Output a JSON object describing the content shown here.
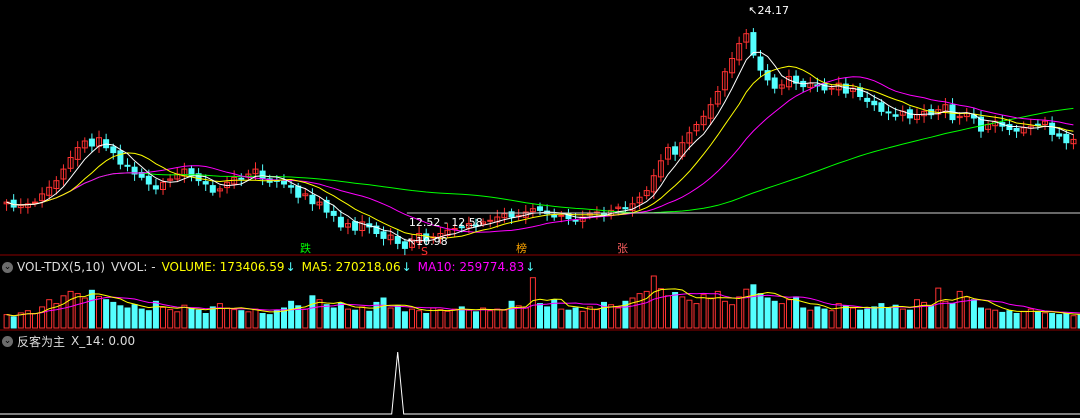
{
  "chart_data": [
    {
      "type": "candlestick",
      "price_range": [
        10.0,
        24.9
      ],
      "overlay_lines": [
        "MA5",
        "MA10",
        "MA20",
        "MA60"
      ],
      "colors": {
        "up": "#ff3232",
        "down": "#54ffff",
        "ma5": "#ffffff",
        "ma10": "#ffff00",
        "ma20": "#ff00ff",
        "ma60": "#00ff00",
        "grid": "#8c0000"
      },
      "closes": [
        12.9,
        12.6,
        12.7,
        12.8,
        12.9,
        13.4,
        13.8,
        14.2,
        14.9,
        15.6,
        16.2,
        16.6,
        16.3,
        16.8,
        16.2,
        15.9,
        15.2,
        15.1,
        14.6,
        14.4,
        14.0,
        13.7,
        14.1,
        14.3,
        14.6,
        14.9,
        14.5,
        14.2,
        14.0,
        13.5,
        13.7,
        14.1,
        14.4,
        14.3,
        14.6,
        14.9,
        14.3,
        14.1,
        14.2,
        14.0,
        13.8,
        13.2,
        13.4,
        12.8,
        12.9,
        12.3,
        12.1,
        11.4,
        11.6,
        11.2,
        11.7,
        11.4,
        11.0,
        10.7,
        10.9,
        10.4,
        10.1,
        10.6,
        11.0,
        10.6,
        10.8,
        11.0,
        11.2,
        11.3,
        11.4,
        11.6,
        11.5,
        11.7,
        11.8,
        12.0,
        12.2,
        12.0,
        12.1,
        12.3,
        12.5,
        12.4,
        12.2,
        12.0,
        12.1,
        11.9,
        11.8,
        12.0,
        12.2,
        12.3,
        12.1,
        12.4,
        12.6,
        12.5,
        12.8,
        13.2,
        13.6,
        14.5,
        15.4,
        16.2,
        15.8,
        16.5,
        17.1,
        17.6,
        18.1,
        18.8,
        19.6,
        20.8,
        21.6,
        22.5,
        23.1,
        21.8,
        20.9,
        20.3,
        19.8,
        20.0,
        20.5,
        20.1,
        19.9,
        20.1,
        20.0,
        19.7,
        19.8,
        20.1,
        19.5,
        19.8,
        19.3,
        19.0,
        18.8,
        18.4,
        18.3,
        18.1,
        18.4,
        18.0,
        18.2,
        18.4,
        18.2,
        18.5,
        18.8,
        17.9,
        18.1,
        18.3,
        18.0,
        17.2,
        17.6,
        17.8,
        17.5,
        17.3,
        17.2,
        17.4,
        17.5,
        17.6,
        17.8,
        17.0,
        16.9,
        16.5,
        16.7
      ],
      "annotations": {
        "high_label": "24.17",
        "low_label": "10.98",
        "range_label": "12.52 - 12.58",
        "marker_down": "跌",
        "marker_s": "S",
        "marker_bang": "榜",
        "marker_up": "张"
      }
    },
    {
      "type": "bar",
      "name": "VOL-TDX(5,10)",
      "series": [
        {
          "name": "VOLUME",
          "latest": "173406.59"
        },
        {
          "name": "MA5",
          "latest": "270218.06"
        },
        {
          "name": "MA10",
          "latest": "259774.83"
        }
      ],
      "volumes": [
        0.28,
        0.24,
        0.31,
        0.35,
        0.3,
        0.42,
        0.55,
        0.48,
        0.62,
        0.7,
        0.66,
        0.58,
        0.72,
        0.61,
        0.55,
        0.5,
        0.44,
        0.4,
        0.46,
        0.38,
        0.35,
        0.52,
        0.41,
        0.37,
        0.33,
        0.45,
        0.39,
        0.36,
        0.3,
        0.42,
        0.48,
        0.4,
        0.37,
        0.35,
        0.33,
        0.38,
        0.3,
        0.28,
        0.36,
        0.4,
        0.52,
        0.44,
        0.38,
        0.62,
        0.55,
        0.46,
        0.4,
        0.49,
        0.38,
        0.36,
        0.42,
        0.34,
        0.5,
        0.58,
        0.4,
        0.44,
        0.33,
        0.38,
        0.35,
        0.3,
        0.4,
        0.37,
        0.34,
        0.38,
        0.42,
        0.36,
        0.33,
        0.4,
        0.35,
        0.38,
        0.36,
        0.52,
        0.44,
        0.4,
        0.95,
        0.48,
        0.42,
        0.55,
        0.38,
        0.36,
        0.4,
        0.34,
        0.42,
        0.37,
        0.5,
        0.46,
        0.4,
        0.52,
        0.58,
        0.66,
        0.7,
        0.98,
        0.75,
        0.62,
        0.68,
        0.6,
        0.54,
        0.48,
        0.64,
        0.58,
        0.7,
        0.52,
        0.46,
        0.6,
        0.74,
        0.82,
        0.66,
        0.58,
        0.52,
        0.48,
        0.55,
        0.6,
        0.4,
        0.36,
        0.42,
        0.38,
        0.35,
        0.48,
        0.44,
        0.4,
        0.36,
        0.38,
        0.42,
        0.48,
        0.4,
        0.45,
        0.38,
        0.36,
        0.55,
        0.5,
        0.44,
        0.76,
        0.52,
        0.48,
        0.7,
        0.6,
        0.55,
        0.4,
        0.38,
        0.36,
        0.32,
        0.35,
        0.3,
        0.34,
        0.38,
        0.33,
        0.31,
        0.3,
        0.28,
        0.3,
        0.26,
        0.28
      ]
    },
    {
      "type": "line",
      "name": "反客为主",
      "series": [
        {
          "name": "X_14",
          "latest": "0.00"
        }
      ],
      "spike_index": 55,
      "spike_value": 1
    }
  ],
  "vol_panel": {
    "indicator": "VOL-TDX(5,10)",
    "vvol_label": "VVOL: -",
    "volume_label": "VOLUME: 173406.59",
    "ma5_label": "MA5: 270218.06",
    "ma10_label": "MA10: 259774.83",
    "arrow": "↓"
  },
  "sub_panel": {
    "indicator": "反客为主",
    "x14_label": "X_14: 0.00"
  },
  "toggle_glyph": "⌄"
}
